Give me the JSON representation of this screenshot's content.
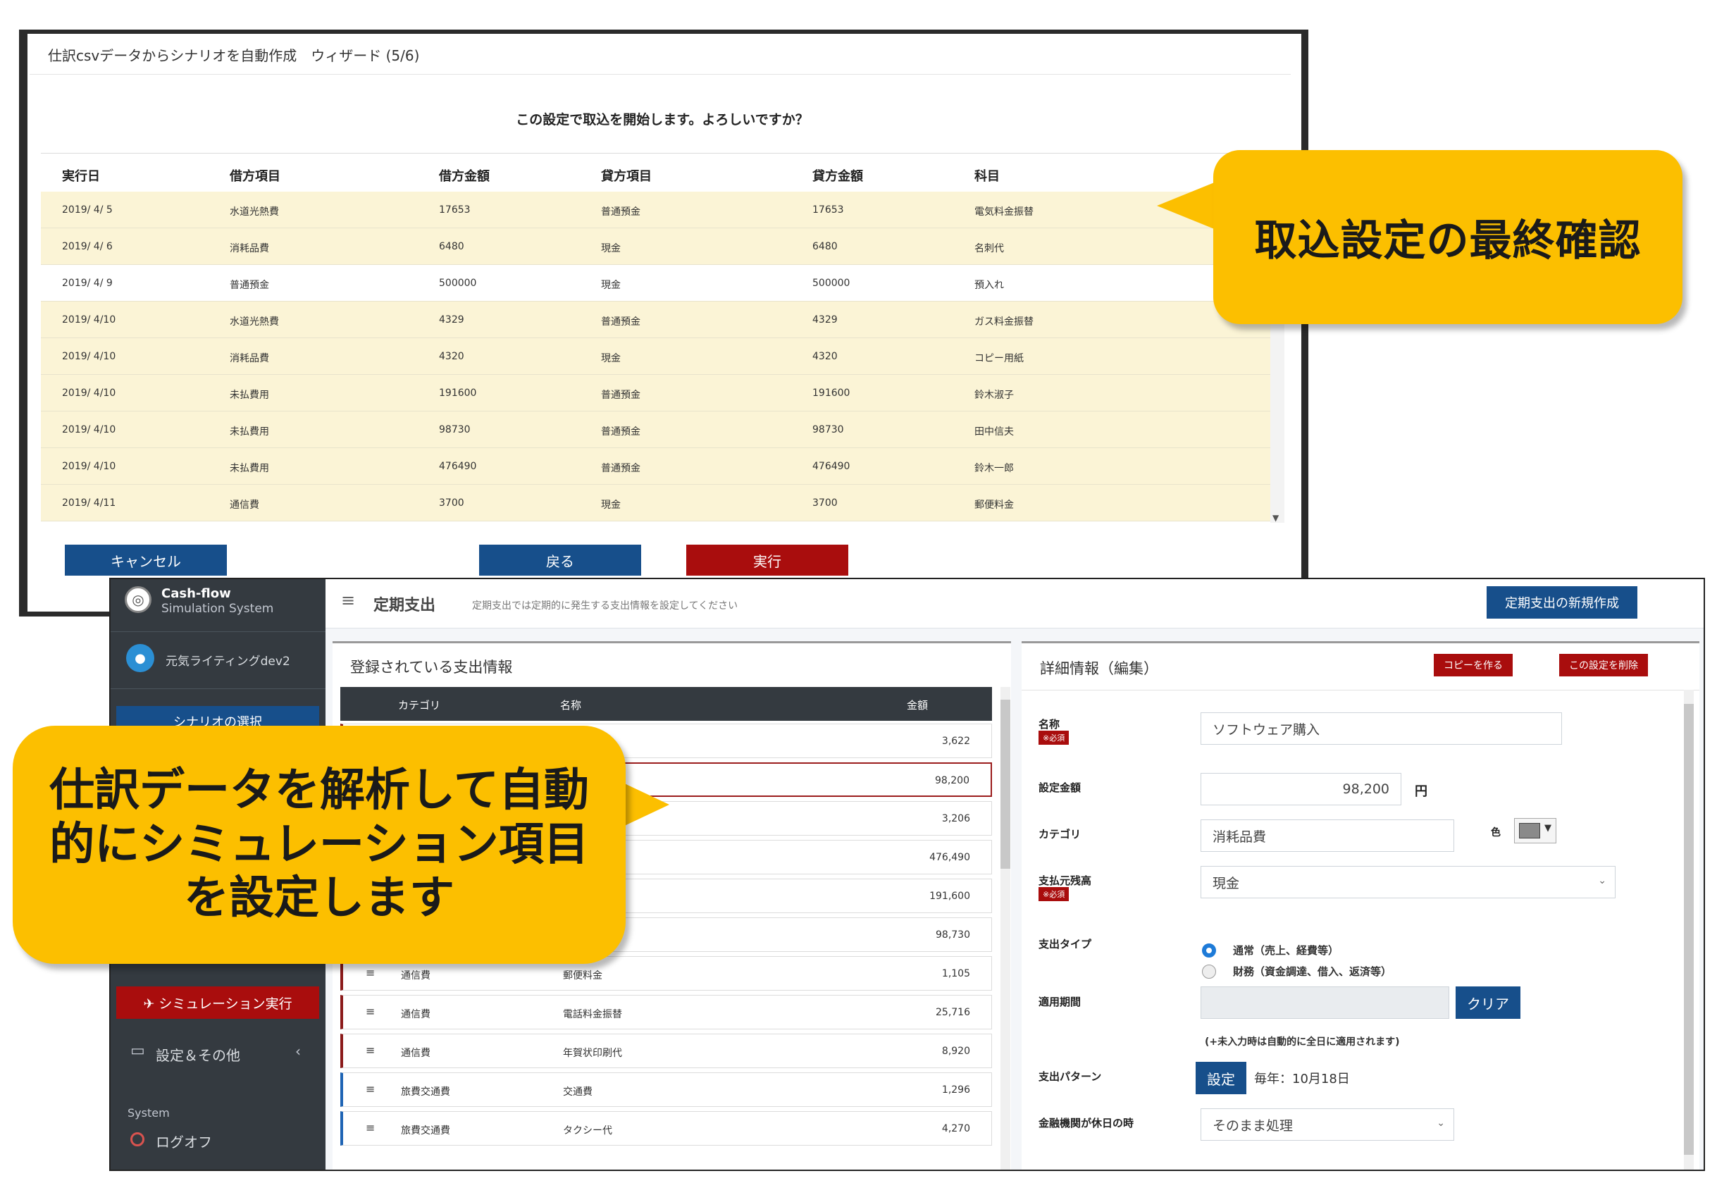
{
  "wizard": {
    "title": "仕訳csvデータからシナリオを自動作成　ウィザード (5/6)",
    "confirm_message": "この設定で取込を開始します。よろしいですか？",
    "columns": [
      "実行日",
      "借方項目",
      "借方金額",
      "貸方項目",
      "貸方金額",
      "科目"
    ],
    "rows": [
      {
        "date": "2019/ 4/ 5",
        "debit_item": "水道光熱費",
        "debit_amount": "17653",
        "credit_item": "普通預金",
        "credit_amount": "17653",
        "subject": "電気料金振替"
      },
      {
        "date": "2019/ 4/ 6",
        "debit_item": "消耗品費",
        "debit_amount": "6480",
        "credit_item": "現金",
        "credit_amount": "6480",
        "subject": "名刺代"
      },
      {
        "date": "2019/ 4/ 9",
        "debit_item": "普通預金",
        "debit_amount": "500000",
        "credit_item": "現金",
        "credit_amount": "500000",
        "subject": "預入れ"
      },
      {
        "date": "2019/ 4/10",
        "debit_item": "水道光熱費",
        "debit_amount": "4329",
        "credit_item": "普通預金",
        "credit_amount": "4329",
        "subject": "ガス料金振替"
      },
      {
        "date": "2019/ 4/10",
        "debit_item": "消耗品費",
        "debit_amount": "4320",
        "credit_item": "現金",
        "credit_amount": "4320",
        "subject": "コピー用紙"
      },
      {
        "date": "2019/ 4/10",
        "debit_item": "未払費用",
        "debit_amount": "191600",
        "credit_item": "普通預金",
        "credit_amount": "191600",
        "subject": "鈴木淑子"
      },
      {
        "date": "2019/ 4/10",
        "debit_item": "未払費用",
        "debit_amount": "98730",
        "credit_item": "普通預金",
        "credit_amount": "98730",
        "subject": "田中信夫"
      },
      {
        "date": "2019/ 4/10",
        "debit_item": "未払費用",
        "debit_amount": "476490",
        "credit_item": "普通預金",
        "credit_amount": "476490",
        "subject": "鈴木一郎"
      },
      {
        "date": "2019/ 4/11",
        "debit_item": "通信費",
        "debit_amount": "3700",
        "credit_item": "現金",
        "credit_amount": "3700",
        "subject": "郵便料金"
      }
    ],
    "buttons": {
      "cancel": "キャンセル",
      "back": "戻る",
      "run": "実行"
    }
  },
  "callouts": {
    "final_check": "取込設定の最終確認",
    "auto_set": "仕訳データを解析して自動的にシミュレーション項目を設定します"
  },
  "app": {
    "brand_title": "Cash-flow",
    "brand_subtitle": "Simulation System",
    "user_name": "元気ライティングdev2",
    "sidebar": {
      "scenario_select": "シナリオの選択",
      "simulation_run": "✈ シミュレーション実行",
      "settings": "設定＆その他",
      "system_label": "System",
      "logoff": "ログオフ"
    },
    "header": {
      "title": "定期支出",
      "description": "定期支出では定期的に発生する支出情報を設定してください",
      "new_button": "定期支出の新規作成"
    },
    "list": {
      "title": "登録されている支出情報",
      "columns": [
        "カテゴリ",
        "名称",
        "金額"
      ],
      "rows": [
        {
          "category": "",
          "name": "",
          "amount": "3,622"
        },
        {
          "category": "",
          "name": "",
          "amount": "98,200"
        },
        {
          "category": "",
          "name": "",
          "amount": "3,206"
        },
        {
          "category": "",
          "name": "",
          "amount": "476,490"
        },
        {
          "category": "",
          "name": "",
          "amount": "191,600"
        },
        {
          "category": "",
          "name": "",
          "amount": "98,730"
        },
        {
          "category": "通信費",
          "name": "郵便料金",
          "amount": "1,105"
        },
        {
          "category": "通信費",
          "name": "電話料金振替",
          "amount": "25,716"
        },
        {
          "category": "通信費",
          "name": "年賀状印刷代",
          "amount": "8,920"
        },
        {
          "category": "旅費交通費",
          "name": "交通費",
          "amount": "1,296"
        },
        {
          "category": "旅費交通費",
          "name": "タクシー代",
          "amount": "4,270"
        }
      ]
    },
    "detail": {
      "title": "詳細情報（編集）",
      "copy_button": "コピーを作る",
      "delete_button": "この設定を削除",
      "required_badge": "※必須",
      "labels": {
        "name": "名称",
        "amount": "設定金額",
        "category": "カテゴリ",
        "source_balance": "支払元残高",
        "payment_type": "支出タイプ",
        "period": "適用期間",
        "pattern": "支出パターン",
        "holiday": "金融機関が休日の時",
        "color": "色"
      },
      "values": {
        "name": "ソフトウェア購入",
        "amount": "98,200",
        "amount_unit": "円",
        "category": "消耗品費",
        "source_balance": "現金",
        "holiday": "そのまま処理",
        "pattern": "毎年：10月18日"
      },
      "radio_options": [
        "通常（売上、経費等）",
        "財務（資金調達、借入、返済等）"
      ],
      "clear_button": "クリア",
      "period_note": "(+未入力時は自動的に全日に適用されます)",
      "setting_button": "設定"
    }
  }
}
